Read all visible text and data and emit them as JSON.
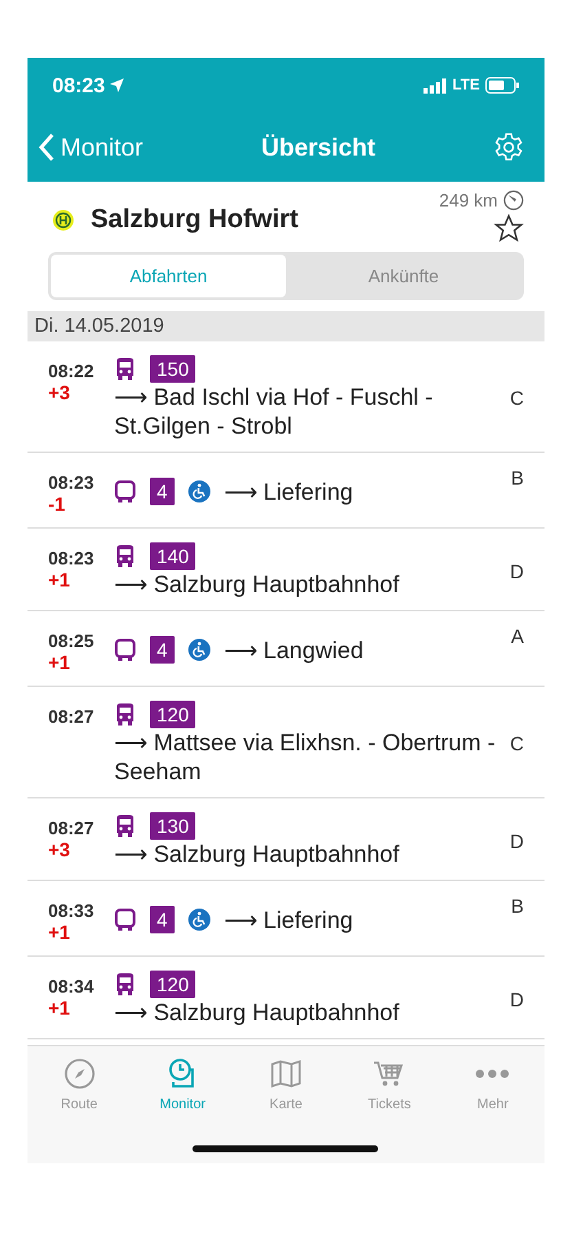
{
  "status_bar": {
    "time": "08:23",
    "network": "LTE"
  },
  "nav_bar": {
    "back": "Monitor",
    "title": "Übersicht"
  },
  "station": {
    "name": "Salzburg Hofwirt",
    "distance": "249 km",
    "favorite": false
  },
  "segments": [
    {
      "label": "Abfahrten",
      "selected": true
    },
    {
      "label": "Ankünfte",
      "selected": false
    }
  ],
  "date": "Di. 14.05.2019",
  "departures": [
    {
      "time": "08:22",
      "delay": "+3",
      "kind": "regional",
      "line": "150",
      "accessible": false,
      "destination": "⟶ Bad Ischl via Hof - Fuschl - St.Gilgen - Strobl",
      "platform": "C"
    },
    {
      "time": "08:23",
      "delay": "-1",
      "kind": "city",
      "line": "4",
      "accessible": true,
      "destination": "⟶ Liefering",
      "platform": "B"
    },
    {
      "time": "08:23",
      "delay": "+1",
      "kind": "regional",
      "line": "140",
      "accessible": false,
      "destination": "⟶ Salzburg Hauptbahnhof",
      "platform": "D"
    },
    {
      "time": "08:25",
      "delay": "+1",
      "kind": "city",
      "line": "4",
      "accessible": true,
      "destination": "⟶ Langwied",
      "platform": "A"
    },
    {
      "time": "08:27",
      "kind": "regional",
      "line": "120",
      "accessible": false,
      "destination": "⟶ Mattsee via Elixhsn. - Obertrum - Seeham",
      "platform": "C"
    },
    {
      "time": "08:27",
      "delay": "+3",
      "kind": "regional",
      "line": "130",
      "accessible": false,
      "destination": "⟶ Salzburg Hauptbahnhof",
      "platform": "D"
    },
    {
      "time": "08:33",
      "delay": "+1",
      "kind": "city",
      "line": "4",
      "accessible": true,
      "destination": "⟶ Liefering",
      "platform": "B"
    },
    {
      "time": "08:34",
      "delay": "+1",
      "kind": "regional",
      "line": "120",
      "accessible": false,
      "destination": "⟶ Salzburg Hauptbahnhof",
      "platform": "D"
    }
  ],
  "tab_bar": [
    {
      "label": "Route",
      "selected": false
    },
    {
      "label": "Monitor",
      "selected": true
    },
    {
      "label": "Karte",
      "selected": false
    },
    {
      "label": "Tickets",
      "selected": false
    },
    {
      "label": "Mehr",
      "selected": false
    }
  ]
}
